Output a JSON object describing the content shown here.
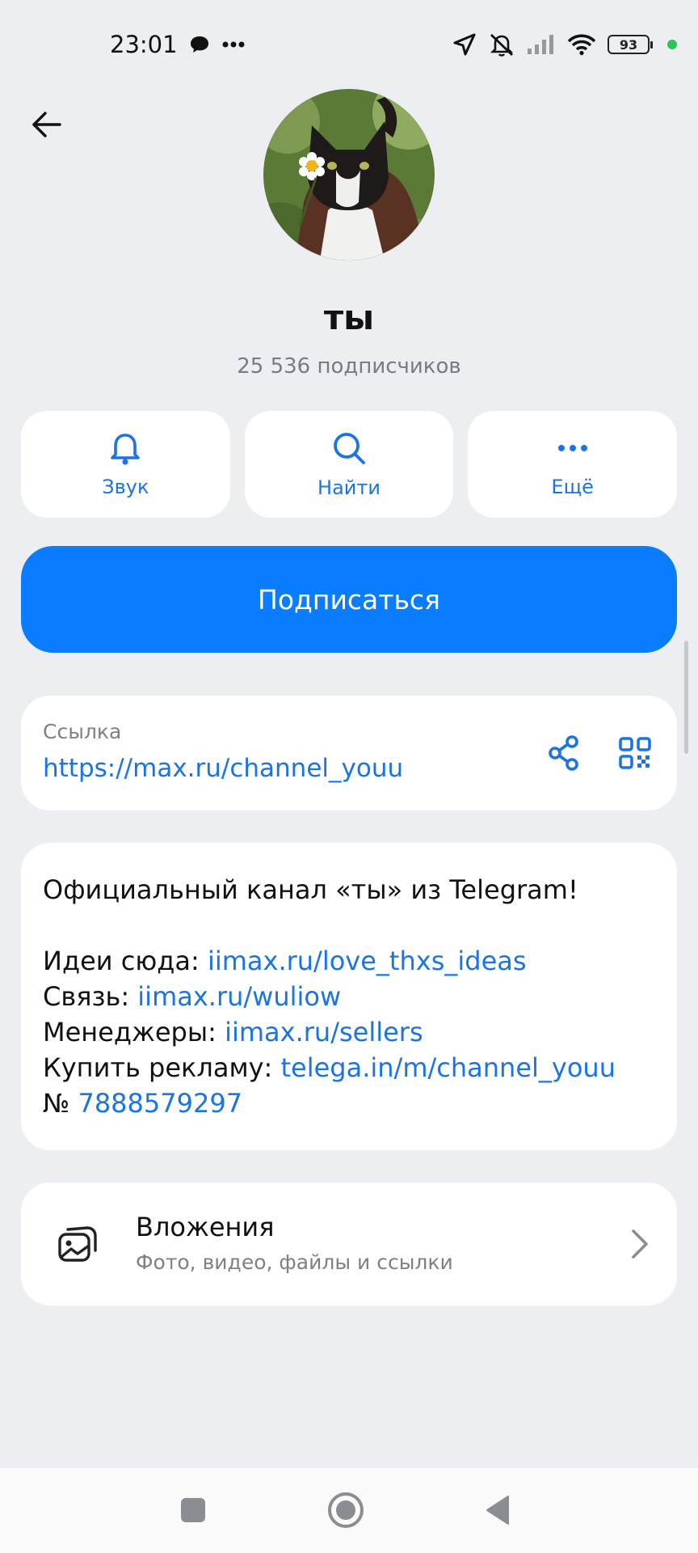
{
  "status_bar": {
    "time": "23:01",
    "battery": "93",
    "icons": [
      "message-icon",
      "more-icon",
      "location-icon",
      "silent-icon",
      "signal-icon",
      "wifi-icon",
      "battery-icon"
    ]
  },
  "channel": {
    "name": "ты",
    "subscribers": "25 536 подписчиков"
  },
  "actions": [
    {
      "label": "Звук",
      "icon": "bell-icon"
    },
    {
      "label": "Найти",
      "icon": "search-icon"
    },
    {
      "label": "Ещё",
      "icon": "more-icon"
    }
  ],
  "subscribe_label": "Подписаться",
  "link": {
    "label": "Ссылка",
    "url": "https://max.ru/channel_youu"
  },
  "description": {
    "intro": "Официальный канал «ты» из Telegram!",
    "lines": [
      {
        "prefix": "Идеи сюда: ",
        "link": "iimax.ru/love_thxs_ideas"
      },
      {
        "prefix": "Связь: ",
        "link": "iimax.ru/wuliow"
      },
      {
        "prefix": "Менеджеры: ",
        "link": "iimax.ru/sellers"
      },
      {
        "prefix": "Купить рекламу: ",
        "link": "telega.in/m/channel_youu"
      },
      {
        "prefix": "№ ",
        "link": "7888579297"
      }
    ]
  },
  "attachments": {
    "title": "Вложения",
    "subtitle": "Фото, видео, файлы и ссылки"
  },
  "colors": {
    "accent": "#0a7cff",
    "link": "#1a74e8",
    "background": "#edeef2"
  }
}
